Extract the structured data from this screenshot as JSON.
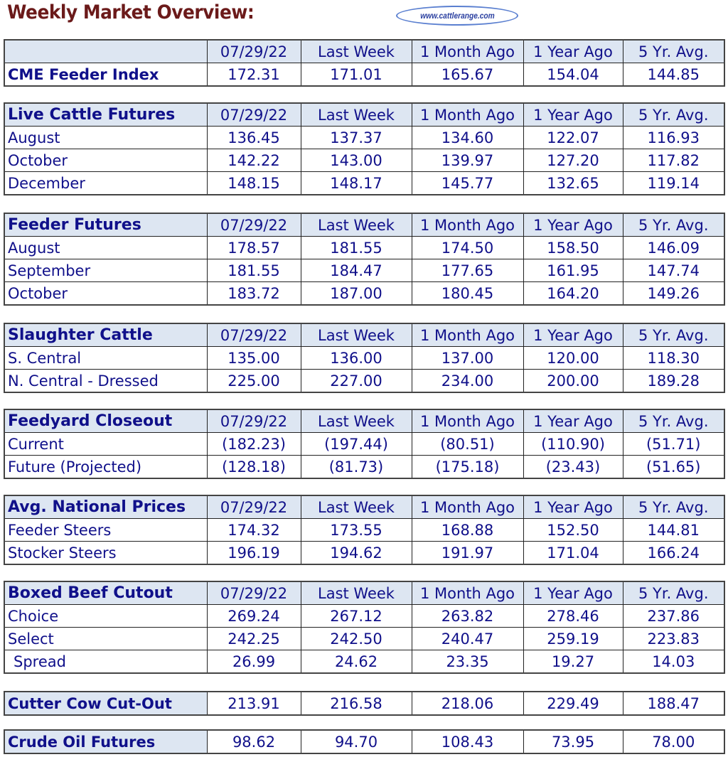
{
  "header": {
    "title": "Weekly Market Overview:",
    "logo_text": "www.cattlerange.com"
  },
  "columns": [
    "07/29/22",
    "Last Week",
    "1 Month Ago",
    "1 Year Ago",
    "5 Yr. Avg."
  ],
  "colors": {
    "text": "#10108a",
    "negative": "#e81010",
    "header_bg": "#dde6f2",
    "title": "#6b1a1a"
  },
  "cme": {
    "label": "CME Feeder Index",
    "values": [
      "172.31",
      "171.01",
      "165.67",
      "154.04",
      "144.85"
    ]
  },
  "live_cattle": {
    "title": "Live Cattle Futures",
    "rows": [
      {
        "label": "August",
        "values": [
          "136.45",
          "137.37",
          "134.60",
          "122.07",
          "116.93"
        ]
      },
      {
        "label": "October",
        "values": [
          "142.22",
          "143.00",
          "139.97",
          "127.20",
          "117.82"
        ]
      },
      {
        "label": "December",
        "values": [
          "148.15",
          "148.17",
          "145.77",
          "132.65",
          "119.14"
        ]
      }
    ]
  },
  "feeder": {
    "title": "Feeder Futures",
    "rows": [
      {
        "label": "August",
        "values": [
          "178.57",
          "181.55",
          "174.50",
          "158.50",
          "146.09"
        ]
      },
      {
        "label": "September",
        "values": [
          "181.55",
          "184.47",
          "177.65",
          "161.95",
          "147.74"
        ]
      },
      {
        "label": "October",
        "values": [
          "183.72",
          "187.00",
          "180.45",
          "164.20",
          "149.26"
        ]
      }
    ]
  },
  "slaughter": {
    "title": "Slaughter Cattle",
    "rows": [
      {
        "label": "S. Central",
        "values": [
          "135.00",
          "136.00",
          "137.00",
          "120.00",
          "118.30"
        ]
      },
      {
        "label": "N. Central - Dressed",
        "values": [
          "225.00",
          "227.00",
          "234.00",
          "200.00",
          "189.28"
        ]
      }
    ]
  },
  "feedyard": {
    "title": "Feedyard Closeout",
    "rows": [
      {
        "label": "Current",
        "values": [
          "(182.23)",
          "(197.44)",
          "(80.51)",
          "(110.90)",
          "(51.71)"
        ]
      },
      {
        "label": "Future (Projected)",
        "values": [
          "(128.18)",
          "(81.73)",
          "(175.18)",
          "(23.43)",
          "(51.65)"
        ]
      }
    ]
  },
  "national": {
    "title": "Avg. National Prices",
    "rows": [
      {
        "label": "Feeder Steers",
        "values": [
          "174.32",
          "173.55",
          "168.88",
          "152.50",
          "144.81"
        ]
      },
      {
        "label": "Stocker Steers",
        "values": [
          "196.19",
          "194.62",
          "191.97",
          "171.04",
          "166.24"
        ]
      }
    ]
  },
  "boxed": {
    "title": "Boxed Beef Cutout",
    "rows": [
      {
        "label": "Choice",
        "values": [
          "269.24",
          "267.12",
          "263.82",
          "278.46",
          "237.86"
        ]
      },
      {
        "label": "Select",
        "values": [
          "242.25",
          "242.50",
          "240.47",
          "259.19",
          "223.83"
        ]
      },
      {
        "label": "Spread",
        "values": [
          "26.99",
          "24.62",
          "23.35",
          "19.27",
          "14.03"
        ]
      }
    ]
  },
  "cutter": {
    "label": "Cutter Cow Cut-Out",
    "values": [
      "213.91",
      "216.58",
      "218.06",
      "229.49",
      "188.47"
    ]
  },
  "crude": {
    "label": "Crude Oil Futures",
    "values": [
      "98.62",
      "94.70",
      "108.43",
      "73.95",
      "78.00"
    ]
  }
}
